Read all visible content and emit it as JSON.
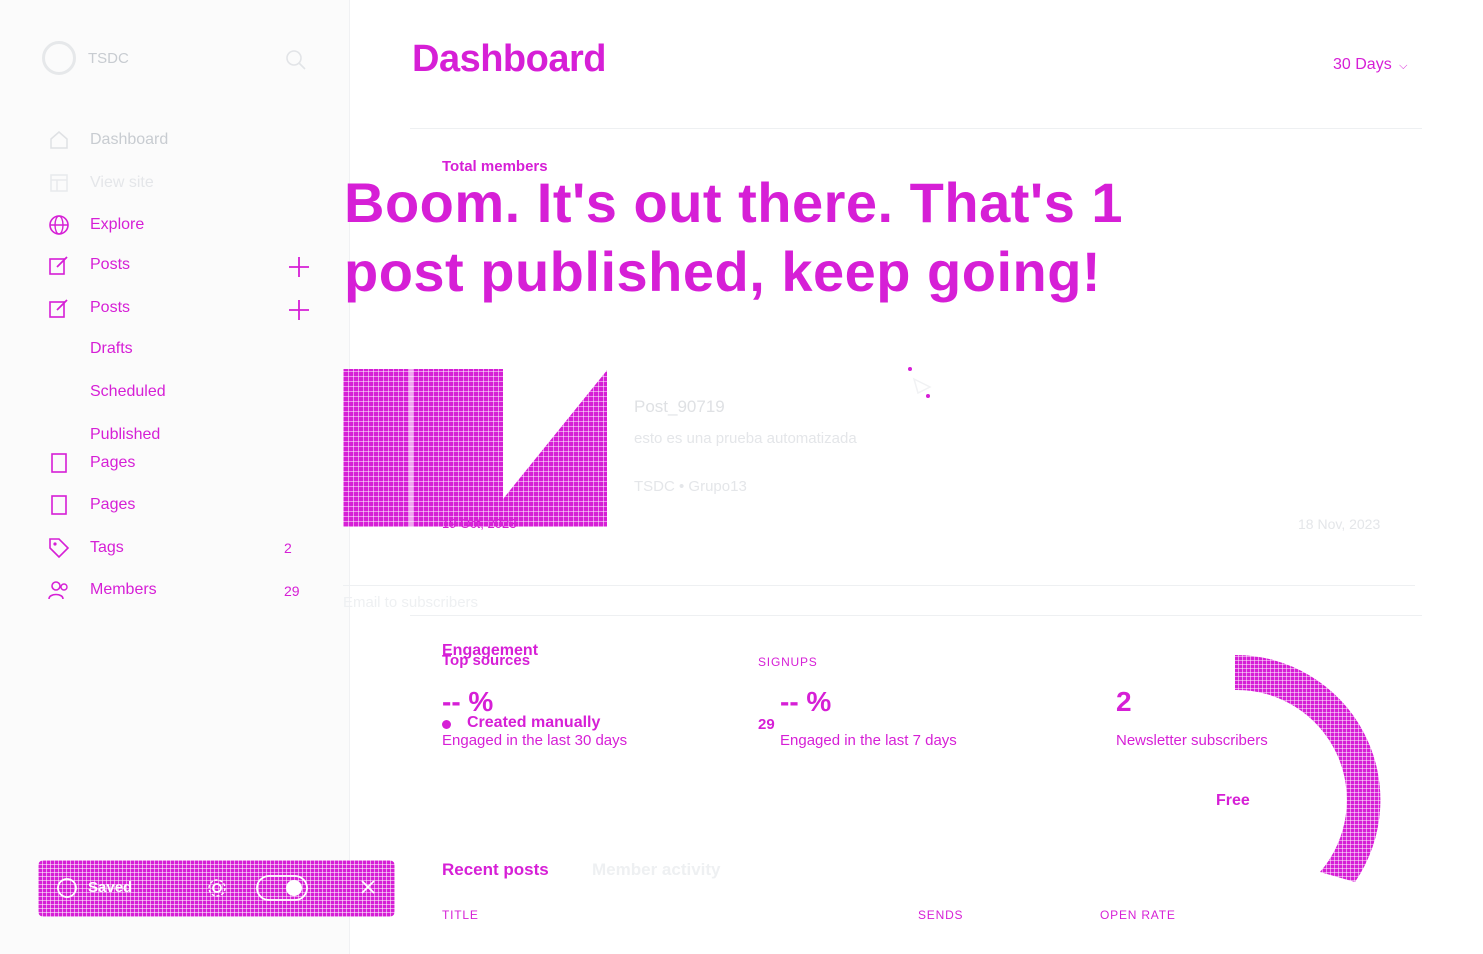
{
  "sidebar": {
    "site_name": "TSDC",
    "nav": [
      {
        "label": "Dashboard"
      },
      {
        "label": "View site"
      },
      {
        "label": "Explore"
      },
      {
        "label": "Posts"
      },
      {
        "label": "Posts"
      },
      {
        "label": "Pages"
      },
      {
        "label": "Pages"
      },
      {
        "label": "Tags"
      },
      {
        "label": "Members",
        "count": "29"
      }
    ],
    "sub_nav": [
      "Drafts",
      "Scheduled",
      "Published"
    ],
    "tags_count": "2",
    "saved_label": "Saved"
  },
  "header": {
    "title": "Dashboard",
    "range": "30 Days"
  },
  "stats": {
    "total_members_label": "Total members"
  },
  "banner": {
    "text": "Boom. It's out there. That's 1 post published, keep going!"
  },
  "post": {
    "title": "Post_90719",
    "excerpt": "esto es una prueba automatizada",
    "meta": "TSDC • Grupo13",
    "date_left": "19 Oct, 2023",
    "date_right": "18 Nov, 2023"
  },
  "ghost_line": "Email to subscribers",
  "engagement": {
    "heading": "Engagement",
    "top_sources": "Top sources",
    "signups_label": "SIGNUPS",
    "source_name": "Created manually",
    "source_count": "29",
    "pct_30": "-- %",
    "pct_30_label": "Engaged in the last 30 days",
    "pct_7": "-- %",
    "pct_7_label": "Engaged in the last 7 days",
    "subscribers": "2",
    "subscribers_label": "Newsletter subscribers",
    "donut_label": "Free"
  },
  "recent": {
    "tabs": [
      "Recent posts",
      "Member activity"
    ],
    "columns": [
      "TITLE",
      "SENDS",
      "OPEN RATE"
    ]
  },
  "colors": {
    "accent": "#d61fd6",
    "ghost_text": "#c8ccd1",
    "background": "#ffffff"
  }
}
